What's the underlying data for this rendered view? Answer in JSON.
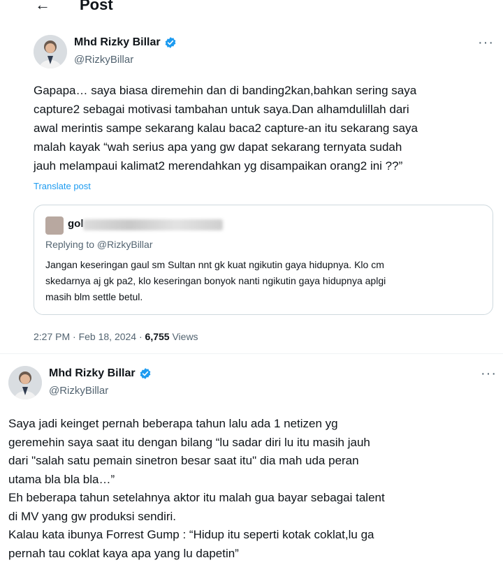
{
  "header": {
    "back_icon": "←",
    "title": "Post"
  },
  "tweet1": {
    "author_name": "Mhd Rizky Billar",
    "author_handle": "@RizkyBillar",
    "more": "···",
    "text": "Gapapa… saya biasa diremehin dan di banding2kan,bahkan sering saya\ncapture2 sebagai motivasi tambahan untuk saya.Dan alhamdulillah dari\nawal merintis sampe sekarang kalau baca2 capture-an itu sekarang saya\nmalah kayak “wah serius apa yang gw dapat sekarang ternyata sudah\njauh melampaui kalimat2 merendahkan yg disampaikan orang2 ini ??”",
    "translate_label": "Translate post",
    "quote": {
      "author_name": "gol",
      "replying_to": "Replying to @RizkyBillar",
      "text": "Jangan keseringan gaul sm Sultan nnt gk kuat ngikutin gaya hidupnya. Klo cm\nskedarnya aj gk pa2, klo keseringan bonyok nanti ngikutin gaya hidupnya aplgi\nmasih blm settle betul."
    },
    "timestamp": "2:27 PM · Feb 18, 2024 · ",
    "views_count": "6,755",
    "views_label": " Views"
  },
  "tweet2": {
    "author_name": "Mhd Rizky Billar",
    "author_handle": "@RizkyBillar",
    "more": "···",
    "text": "Saya jadi keinget pernah beberapa tahun lalu ada 1 netizen yg\ngeremehin saya saat itu dengan bilang “lu sadar diri lu itu masih jauh\ndari \"salah satu pemain sinetron besar saat itu\" dia mah uda peran\nutama bla bla bla…”\nEh beberapa tahun setelahnya aktor itu malah gua bayar sebagai talent\ndi MV yang gw produksi sendiri.\nKalau kata ibunya Forrest Gump : “Hidup itu seperti kotak coklat,lu ga\npernah tau coklat kaya apa yang lu dapetin”"
  },
  "colors": {
    "accent": "#1d9bf0",
    "secondary_text": "#536471",
    "border": "#cfd9de"
  }
}
